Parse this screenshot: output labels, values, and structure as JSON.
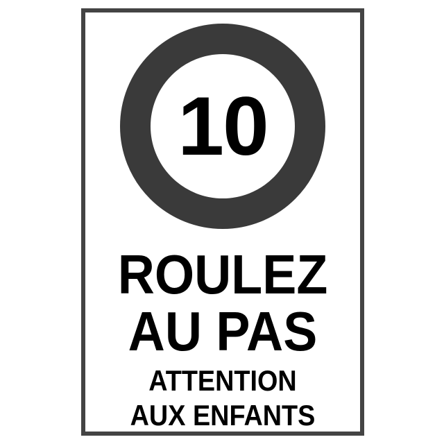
{
  "sign": {
    "speed_limit": "10",
    "line1": "ROULEZ",
    "line2": "AU PAS",
    "line3": "ATTENTION",
    "line4": "AUX ENFANTS"
  },
  "colors": {
    "frame": "#444444",
    "ring": "#3a3a3a",
    "text": "#000000",
    "background": "#ffffff"
  }
}
